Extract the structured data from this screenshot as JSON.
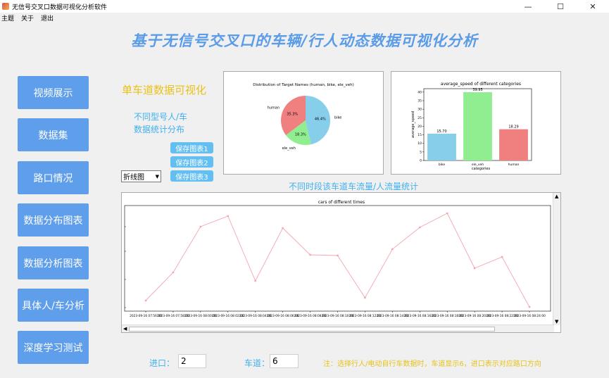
{
  "window": {
    "title": "无信号交叉口数据可视化分析软件",
    "min": "—",
    "max": "☐",
    "close": "✕"
  },
  "menu": [
    "主题",
    "关于",
    "退出"
  ],
  "main_title": "基于无信号交叉口的车辆/行人动态数据可视化分析",
  "nav": [
    "视频展示",
    "数据集",
    "路口情况",
    "数据分布图表",
    "数据分析图表",
    "具体人/车分析",
    "深度学习测试"
  ],
  "section_title": "单车道数据可视化",
  "stats_label_1": "不同型号人/车",
  "stats_label_2": "数据统计分布",
  "save_buttons": [
    "保存图表1",
    "保存图表2",
    "保存图表3"
  ],
  "chart_type_select": "折线图",
  "flow_title": "不同时段该车道车流量/人流量统计",
  "entrance_label": "进口：",
  "entrance_value": "2",
  "lane_label": "车道：",
  "lane_value": "6",
  "note": "注：选择行人/电动自行车数据时，车道显示6，进口表示对应路口方向",
  "colors": {
    "accent": "#5e9eea",
    "yellow": "#e8c21a",
    "blue": "#3fb0f0",
    "line": "#f4a6b0"
  },
  "chart_data": [
    {
      "type": "pie",
      "title": "Distribution of Target Names (human, bike, ele_veh)",
      "labels": [
        "human",
        "ele_veh",
        "bike"
      ],
      "values": [
        35.3,
        18.3,
        46.4
      ],
      "value_labels": [
        "35.3%",
        "18.3%",
        "46.4%"
      ],
      "colors": [
        "#f08080",
        "#90ee90",
        "#87ceeb"
      ]
    },
    {
      "type": "bar",
      "title": "average_speed of different categories",
      "categories": [
        "bike",
        "ele_veh",
        "human"
      ],
      "values": [
        15.7,
        39.95,
        18.29
      ],
      "value_labels": [
        "15.70",
        "39.95",
        "18.29"
      ],
      "colors": [
        "#87ceeb",
        "#90ee90",
        "#f08080"
      ],
      "xlabel": "categories",
      "ylabel": "average_speed",
      "ylim": [
        0,
        42
      ],
      "yticks": [
        "0",
        "5",
        "10",
        "15",
        "20",
        "25",
        "30",
        "35",
        "40"
      ]
    },
    {
      "type": "line",
      "title": "cars of different times",
      "x": [
        "2023-09-16 07:56:00",
        "2023-09-16 07:58:00",
        "2023-09-16 08:00:00",
        "2023-09-16 08:02:00",
        "2023-09-16 08:04:00",
        "2023-09-16 08:06:00",
        "2023-09-16 08:08:00",
        "2023-09-16 08:10:00",
        "2023-09-16 08:12:00",
        "2023-09-16 08:14:00",
        "2023-09-16 08:16:00",
        "2023-09-16 08:18:00",
        "2023-09-16 08:20:00",
        "2023-09-16 08:22:00",
        "2023-09-16 08:24:00"
      ],
      "values": [
        1,
        5,
        11.5,
        13,
        3.8,
        11.3,
        7.5,
        7.4,
        1.4,
        8.3,
        11.4,
        13.4,
        5.6,
        7.2,
        0.1
      ],
      "ylim": [
        -0.5,
        14.5
      ],
      "color": "#f4a6b0"
    }
  ]
}
